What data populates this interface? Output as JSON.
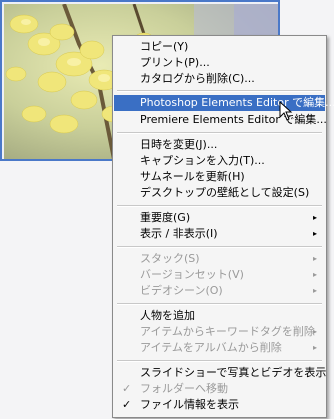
{
  "thumbnail": {
    "description_icon": "flower-photo-thumbnail",
    "frame_color": "#4a78c8"
  },
  "menu": {
    "items": [
      {
        "label": "コピー(Y)",
        "state": "normal"
      },
      {
        "label": "プリント(P)...",
        "state": "normal"
      },
      {
        "label": "カタログから削除(C)...",
        "state": "normal"
      },
      {
        "label": "Photoshop Elements Editor で編集...",
        "state": "highlight"
      },
      {
        "label": "Premiere Elements Editor で編集...",
        "state": "normal"
      },
      {
        "label": "日時を変更(J)...",
        "state": "normal"
      },
      {
        "label": "キャプションを入力(T)...",
        "state": "normal"
      },
      {
        "label": "サムネールを更新(H)",
        "state": "normal"
      },
      {
        "label": "デスクトップの壁紙として設定(S)",
        "state": "normal"
      },
      {
        "label": "重要度(G)",
        "state": "normal",
        "submenu": true
      },
      {
        "label": "表示 / 非表示(I)",
        "state": "normal",
        "submenu": true
      },
      {
        "label": "スタック(S)",
        "state": "disabled",
        "submenu": true
      },
      {
        "label": "バージョンセット(V)",
        "state": "disabled",
        "submenu": true
      },
      {
        "label": "ビデオシーン(O)",
        "state": "disabled",
        "submenu": true
      },
      {
        "label": "人物を追加",
        "state": "normal"
      },
      {
        "label": "アイテムからキーワードタグを削除",
        "state": "disabled",
        "submenu": true
      },
      {
        "label": "アイテムをアルバムから削除",
        "state": "disabled",
        "submenu": true
      },
      {
        "label": "スライドショーで写真とビデオを表示",
        "state": "normal"
      },
      {
        "label": "フォルダーへ移動",
        "state": "disabled",
        "checked": true
      },
      {
        "label": "ファイル情報を表示",
        "state": "normal",
        "checked": true
      }
    ],
    "submenu_arrow": "▸",
    "check_mark": "✓",
    "highlight_color": "#3a6fc4"
  }
}
